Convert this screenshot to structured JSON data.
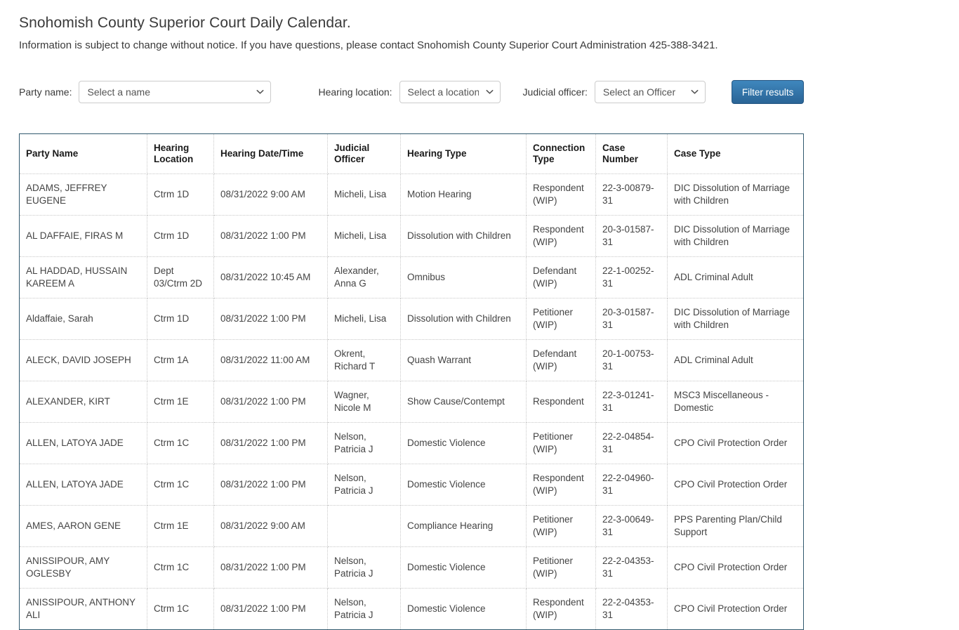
{
  "header": {
    "title": "Snohomish County Superior Court Daily Calendar.",
    "subtitle": "Information is subject to change without notice. If you have questions, please contact Snohomish County Superior Court Administration 425-388-3421."
  },
  "filters": {
    "party_label": "Party name:",
    "party_value": "Select a name",
    "location_label": "Hearing location:",
    "location_value": "Select a location",
    "officer_label": "Judicial officer:",
    "officer_value": "Select an Officer",
    "filter_button": "Filter results",
    "chevron_icon": "chevron-down-icon",
    "button_color": "#2a6496"
  },
  "table": {
    "columns": [
      "Party Name",
      "Hearing Location",
      "Hearing Date/Time",
      "Judicial Officer",
      "Hearing Type",
      "Connection Type",
      "Case Number",
      "Case Type"
    ],
    "rows": [
      {
        "party": "ADAMS, JEFFREY EUGENE",
        "location": "Ctrm 1D",
        "datetime": "08/31/2022 9:00 AM",
        "officer": "Micheli, Lisa",
        "hearing": "Motion Hearing",
        "connection": "Respondent (WIP)",
        "case_number": "22-3-00879-31",
        "case_type": "DIC Dissolution of Marriage with Children"
      },
      {
        "party": "AL DAFFAIE, FIRAS M",
        "location": "Ctrm 1D",
        "datetime": "08/31/2022 1:00 PM",
        "officer": "Micheli, Lisa",
        "hearing": "Dissolution with Children",
        "connection": "Respondent (WIP)",
        "case_number": "20-3-01587-31",
        "case_type": "DIC Dissolution of Marriage with Children"
      },
      {
        "party": "AL HADDAD, HUSSAIN KAREEM A",
        "location": "Dept 03/Ctrm 2D",
        "datetime": "08/31/2022 10:45 AM",
        "officer": "Alexander, Anna G",
        "hearing": "Omnibus",
        "connection": "Defendant (WIP)",
        "case_number": "22-1-00252-31",
        "case_type": "ADL Criminal Adult"
      },
      {
        "party": "Aldaffaie, Sarah",
        "location": "Ctrm 1D",
        "datetime": "08/31/2022 1:00 PM",
        "officer": "Micheli, Lisa",
        "hearing": "Dissolution with Children",
        "connection": "Petitioner (WIP)",
        "case_number": "20-3-01587-31",
        "case_type": "DIC Dissolution of Marriage with Children"
      },
      {
        "party": "ALECK, DAVID JOSEPH",
        "location": "Ctrm 1A",
        "datetime": "08/31/2022 11:00 AM",
        "officer": "Okrent, Richard T",
        "hearing": "Quash Warrant",
        "connection": "Defendant (WIP)",
        "case_number": "20-1-00753-31",
        "case_type": "ADL Criminal Adult"
      },
      {
        "party": "ALEXANDER, KIRT",
        "location": "Ctrm 1E",
        "datetime": "08/31/2022 1:00 PM",
        "officer": "Wagner, Nicole M",
        "hearing": "Show Cause/Contempt",
        "connection": "Respondent",
        "case_number": "22-3-01241-31",
        "case_type": "MSC3 Miscellaneous - Domestic"
      },
      {
        "party": "ALLEN, LATOYA JADE",
        "location": "Ctrm 1C",
        "datetime": "08/31/2022 1:00 PM",
        "officer": "Nelson, Patricia J",
        "hearing": "Domestic Violence",
        "connection": "Petitioner (WIP)",
        "case_number": "22-2-04854-31",
        "case_type": "CPO Civil Protection Order"
      },
      {
        "party": "ALLEN, LATOYA JADE",
        "location": "Ctrm 1C",
        "datetime": "08/31/2022 1:00 PM",
        "officer": "Nelson, Patricia J",
        "hearing": "Domestic Violence",
        "connection": "Respondent (WIP)",
        "case_number": "22-2-04960-31",
        "case_type": "CPO Civil Protection Order"
      },
      {
        "party": "AMES, AARON GENE",
        "location": "Ctrm 1E",
        "datetime": "08/31/2022 9:00 AM",
        "officer": "",
        "hearing": "Compliance Hearing",
        "connection": "Petitioner (WIP)",
        "case_number": "22-3-00649-31",
        "case_type": "PPS Parenting Plan/Child Support"
      },
      {
        "party": "ANISSIPOUR, AMY OGLESBY",
        "location": "Ctrm 1C",
        "datetime": "08/31/2022 1:00 PM",
        "officer": "Nelson, Patricia J",
        "hearing": "Domestic Violence",
        "connection": "Petitioner (WIP)",
        "case_number": "22-2-04353-31",
        "case_type": "CPO Civil Protection Order"
      },
      {
        "party": "ANISSIPOUR, ANTHONY ALI",
        "location": "Ctrm 1C",
        "datetime": "08/31/2022 1:00 PM",
        "officer": "Nelson, Patricia J",
        "hearing": "Domestic Violence",
        "connection": "Respondent (WIP)",
        "case_number": "22-2-04353-31",
        "case_type": "CPO Civil Protection Order"
      }
    ]
  }
}
